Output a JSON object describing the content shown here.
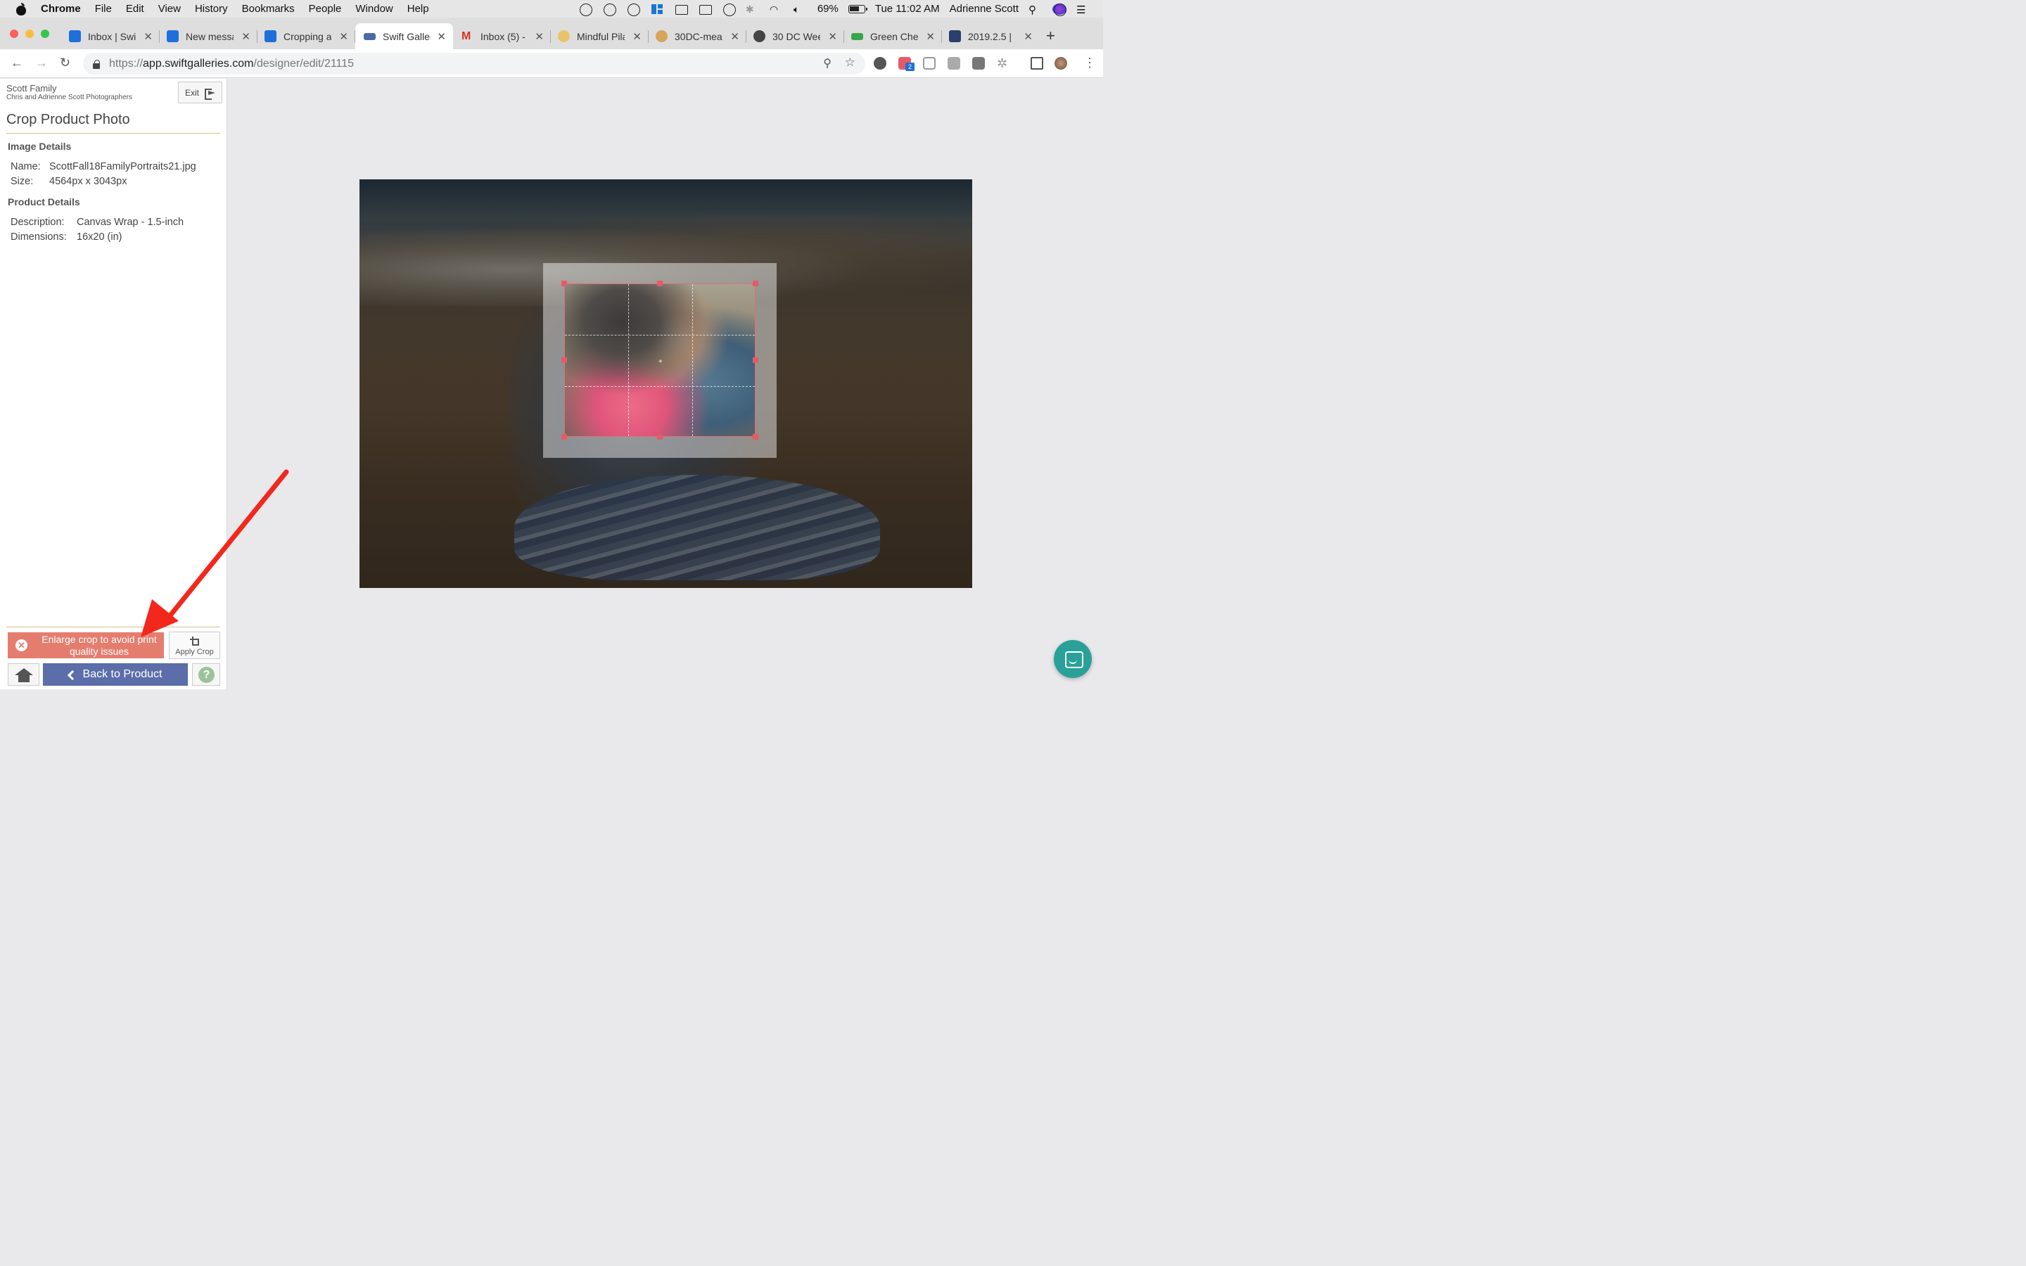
{
  "menubar": {
    "app": "Chrome",
    "items": [
      "File",
      "Edit",
      "View",
      "History",
      "Bookmarks",
      "People",
      "Window",
      "Help"
    ],
    "battery": "69%",
    "clock": "Tue 11:02 AM",
    "user": "Adrienne Scott"
  },
  "tabs": [
    {
      "label": "Inbox | Swi",
      "favicon_color": "#1e6fd9",
      "icon": "calendar-icon"
    },
    {
      "label": "New messa",
      "favicon_color": "#1e6fd9",
      "icon": "intercom-icon"
    },
    {
      "label": "Cropping a",
      "favicon_color": "#1e6fd9",
      "icon": "intercom-icon"
    },
    {
      "label": "Swift Galler",
      "favicon_color": "#4b6aa8",
      "icon": "swift-galleries-icon",
      "active": true
    },
    {
      "label": "Inbox (5) -",
      "favicon_color": "#d93025",
      "icon": "gmail-icon"
    },
    {
      "label": "Mindful Pila",
      "favicon_color": "#e7c46a",
      "icon": "crown-icon"
    },
    {
      "label": "30DC-mea",
      "favicon_color": "#d6a45a",
      "icon": "crown-icon"
    },
    {
      "label": "30 DC Wee",
      "favicon_color": "#444444",
      "icon": "globe-icon"
    },
    {
      "label": "Green Che",
      "favicon_color": "#3aa64a",
      "icon": "green-chef-icon"
    },
    {
      "label": "2019.2.5 |",
      "favicon_color": "#2a3f6b",
      "icon": "trello-icon"
    }
  ],
  "address": {
    "scheme": "https://",
    "host": "app.swiftgalleries.com",
    "path": "/designer/edit/21115",
    "extension_badge": "2"
  },
  "sidebar": {
    "studio_name": "Scott Family",
    "studio_sub": "Chris and Adrienne Scott Photographers",
    "exit_label": "Exit",
    "title": "Crop Product Photo",
    "image_details": {
      "heading": "Image Details",
      "name_label": "Name:",
      "name_value": "ScottFall18FamilyPortraits21.jpg",
      "size_label": "Size:",
      "size_value": "4564px x 3043px"
    },
    "product_details": {
      "heading": "Product Details",
      "desc_label": "Description:",
      "desc_value": "Canvas Wrap - 1.5-inch",
      "dim_label": "Dimensions:",
      "dim_value": "16x20 (in)"
    },
    "warning": "Enlarge crop to avoid print quality issues",
    "apply_crop": "Apply Crop",
    "back_label": "Back to Product",
    "help_label": "?"
  },
  "colors": {
    "accent_blue": "#5b6eaa",
    "warning_red": "#e57d6f",
    "crop_handle": "#e65a68",
    "chat_teal": "#2aa198",
    "rule_gold": "#d8c08a"
  }
}
